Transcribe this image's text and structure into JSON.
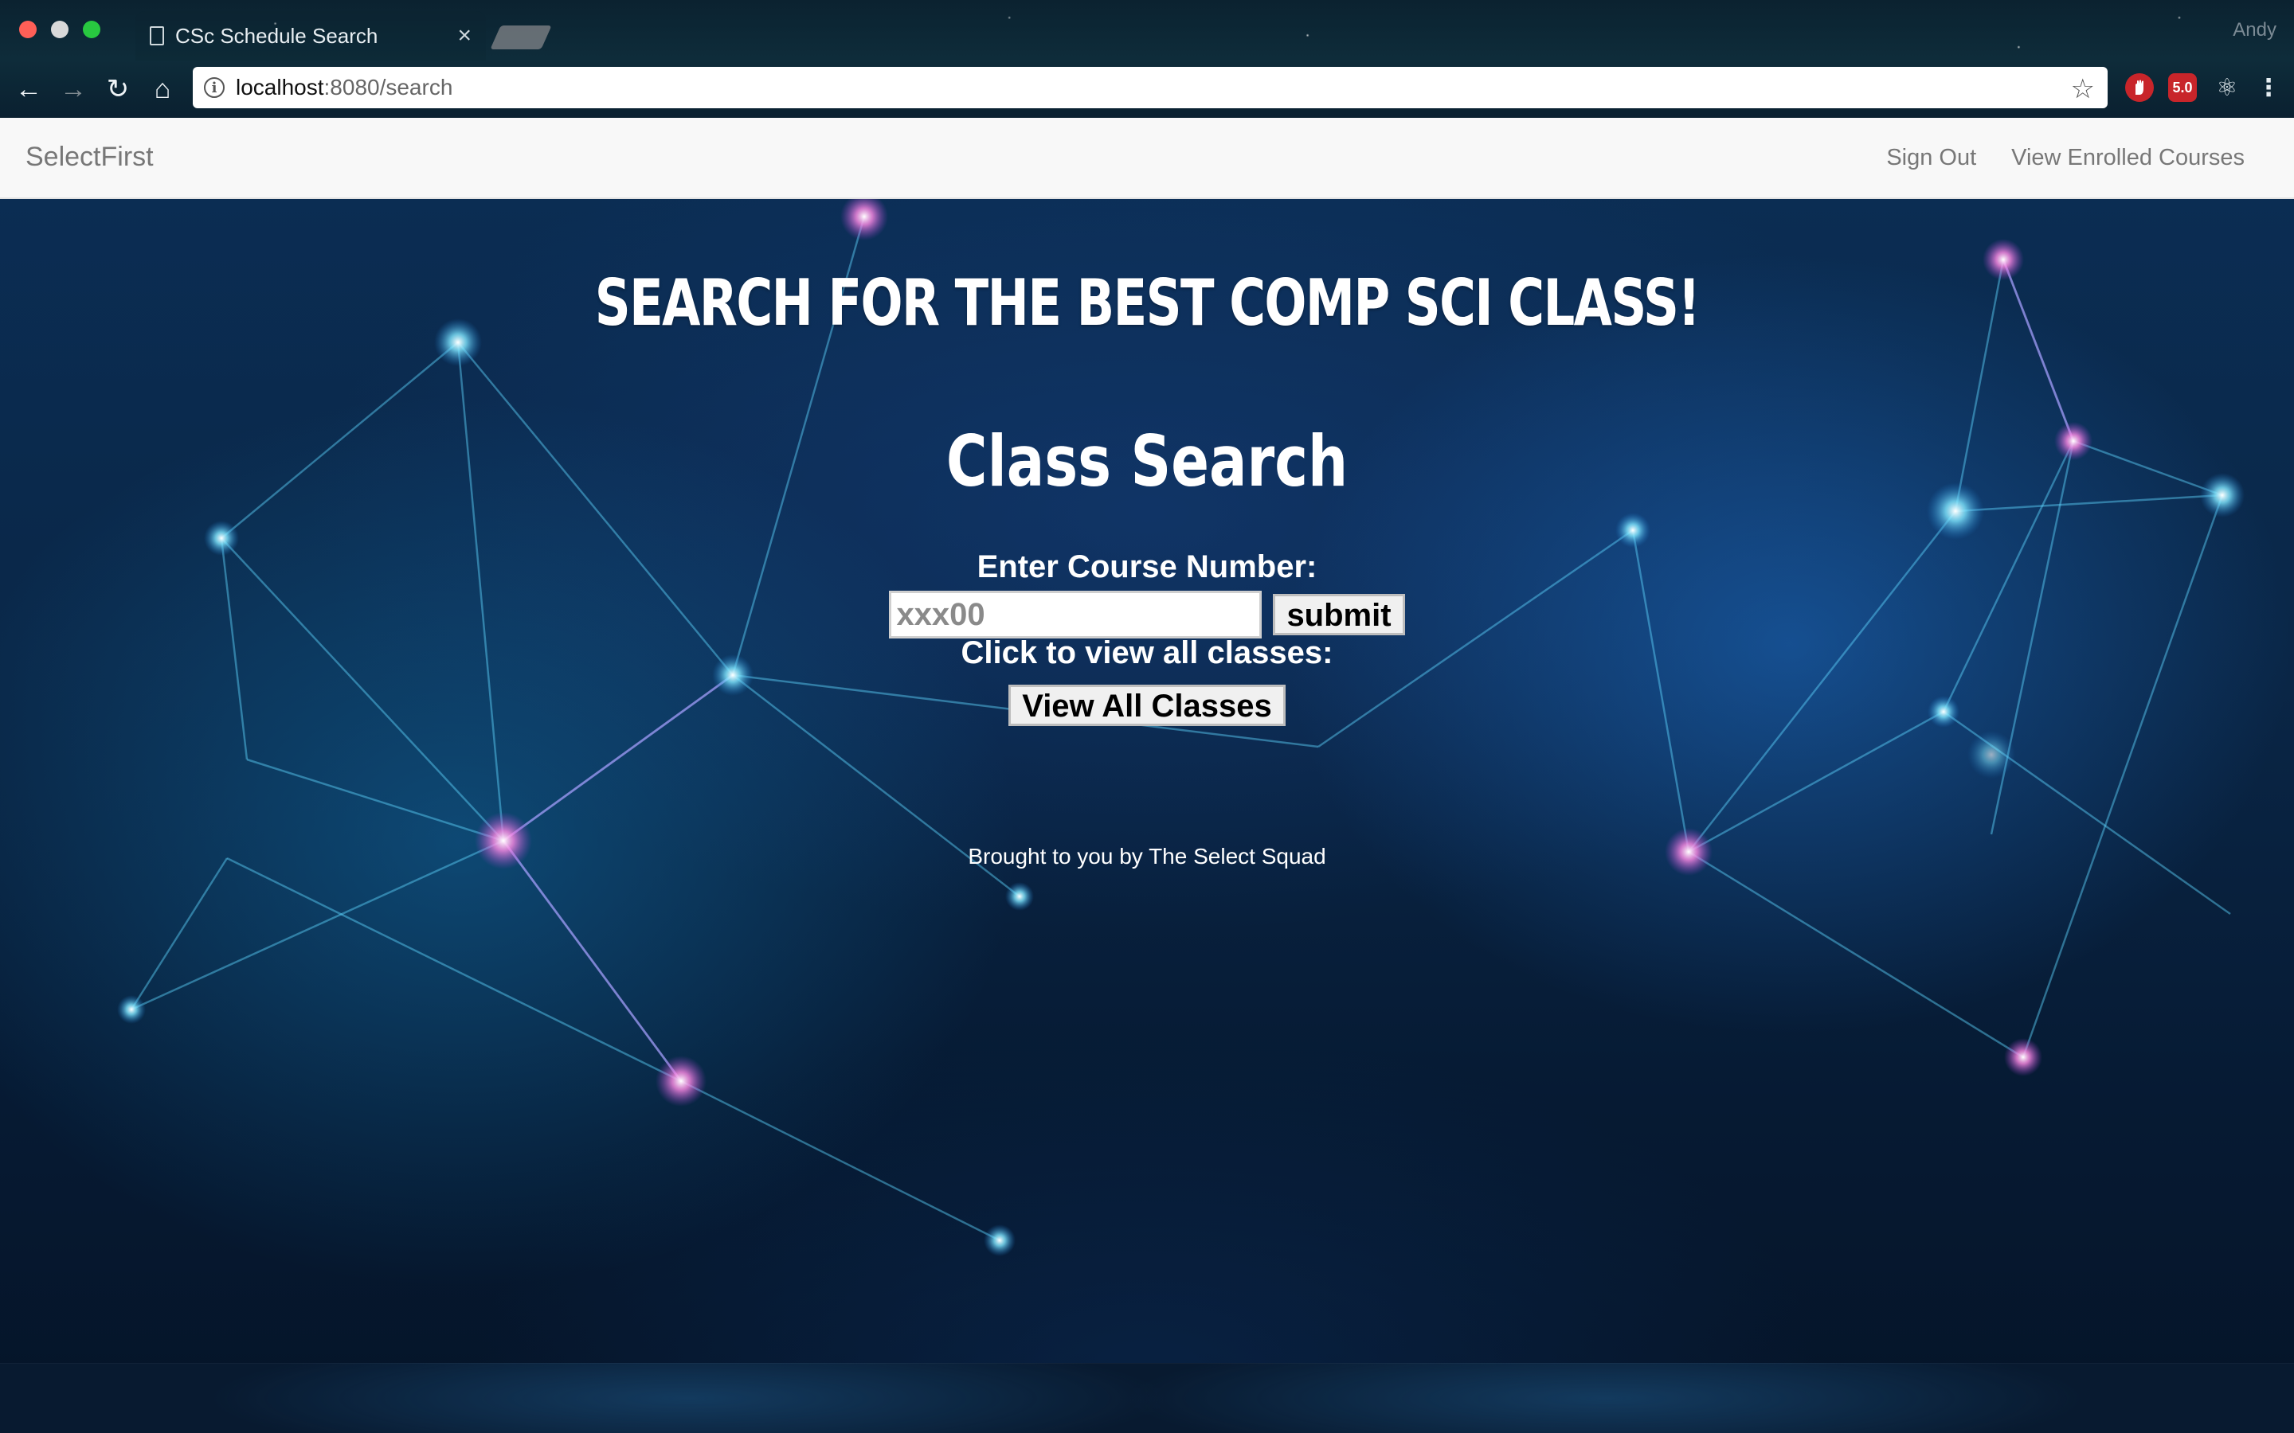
{
  "browser": {
    "tab_title": "CSc Schedule Search",
    "tab_close": "×",
    "profile_name": "Andy",
    "url_host": "localhost",
    "url_rest": ":8080/search",
    "extension_badge": "5.0",
    "back_icon": "←",
    "forward_icon": "→",
    "reload_icon": "↻",
    "home_icon": "⌂",
    "star_icon": "☆",
    "info_icon": "i",
    "react_icon": "⚛",
    "menu_icon": "⋮"
  },
  "navbar": {
    "brand": "SelectFirst",
    "links": [
      "Sign Out",
      "View Enrolled Courses"
    ]
  },
  "main": {
    "headline": "SEARCH FOR THE BEST COMP SCI CLASS!",
    "subhead": "Class Search",
    "course_label": "Enter Course Number:",
    "course_placeholder": "xxx00",
    "submit_label": "submit",
    "view_label": "Click to view all classes:",
    "view_all_label": "View All Classes",
    "footer": "Brought to you by The Select Squad"
  },
  "colors": {
    "navbar_bg": "#f8f8f8",
    "navbar_text": "#777777",
    "page_text": "#ffffff",
    "accent_red": "#c8252a"
  }
}
